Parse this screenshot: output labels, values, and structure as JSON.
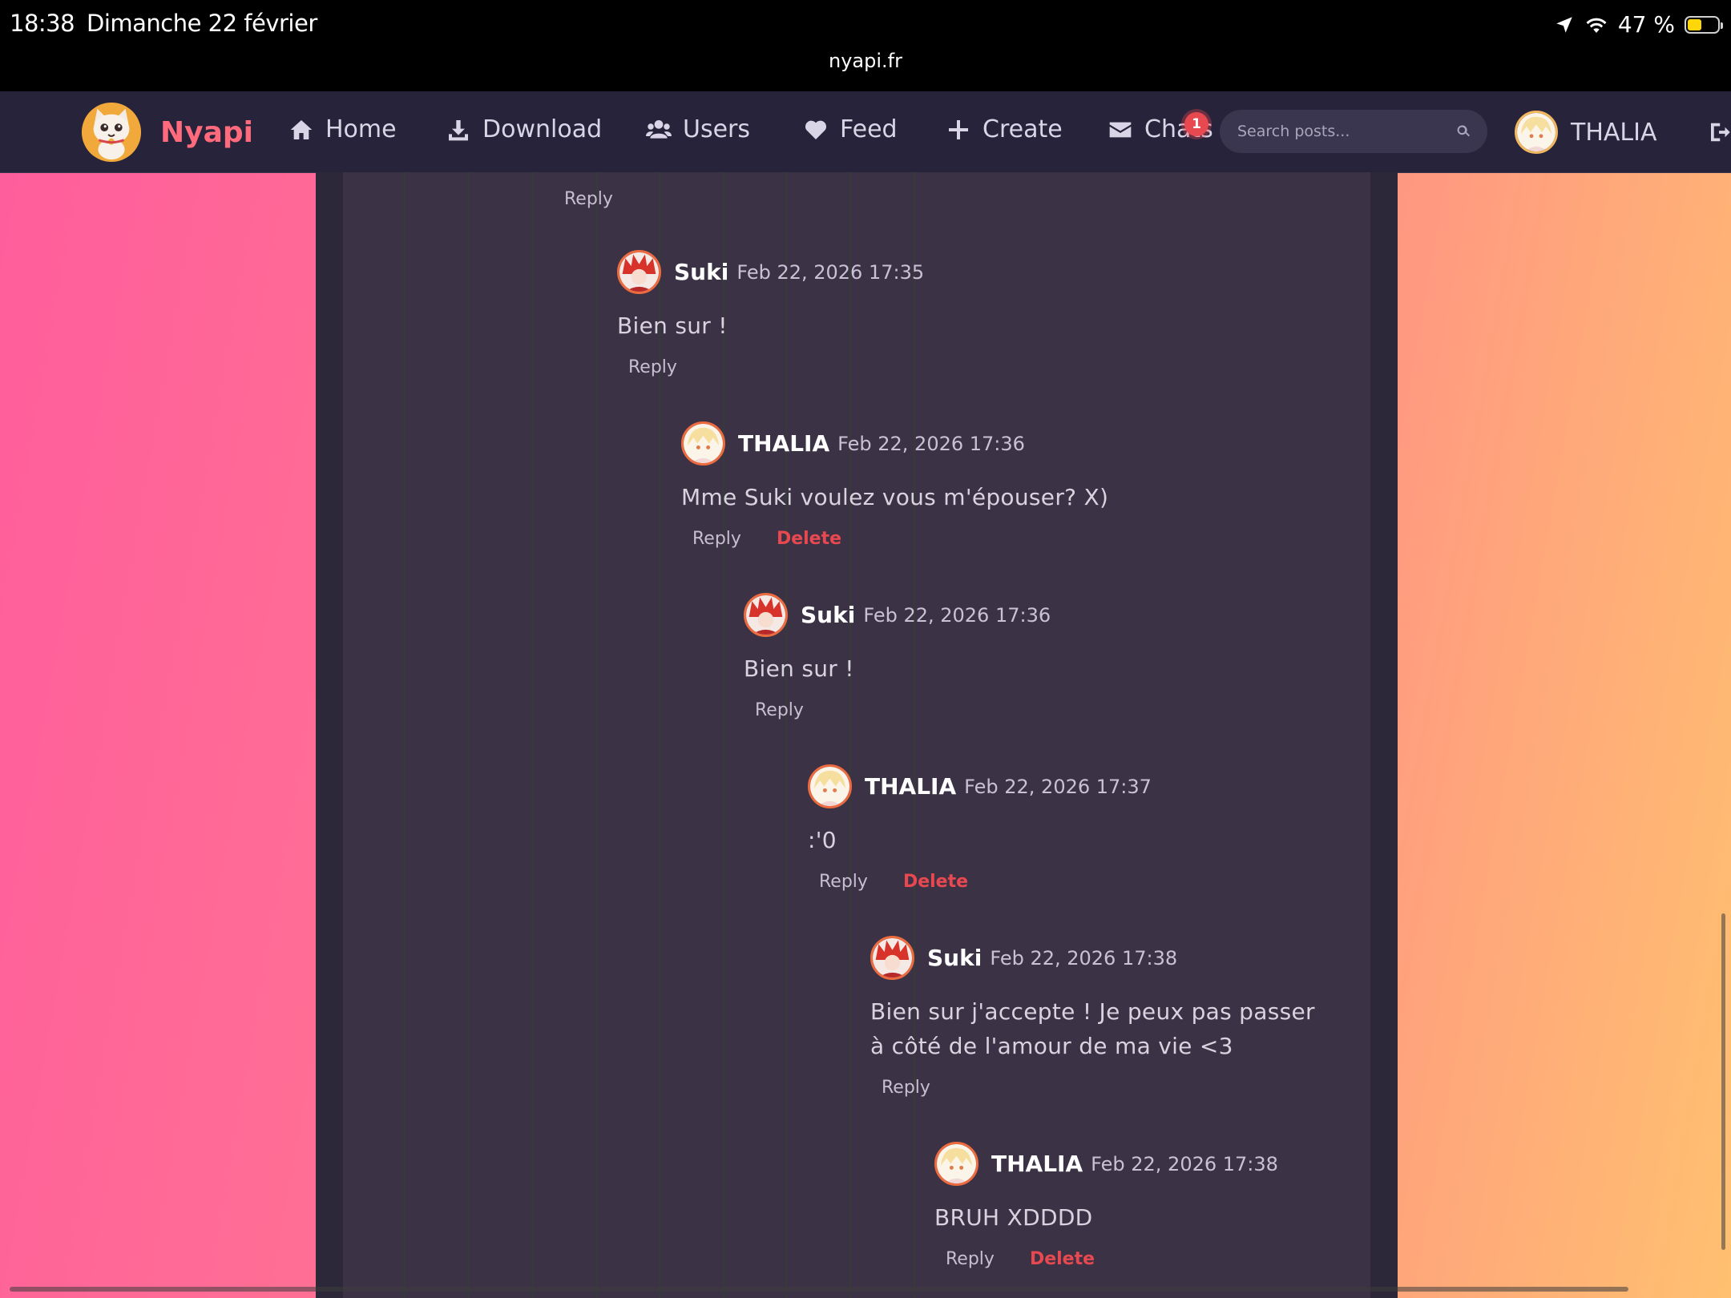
{
  "status_bar": {
    "time": "18:38",
    "date": "Dimanche 22 février",
    "url": "nyapi.fr",
    "battery": "47 %",
    "battery_level_percent": 47
  },
  "nav": {
    "brand": "Nyapi",
    "items": [
      "Home",
      "Download",
      "Users",
      "Feed",
      "Create",
      "Chats"
    ],
    "chat_badge": "1",
    "search_placeholder": "Search posts...",
    "user": "THALIA"
  },
  "thread": {
    "top_reply": "Reply",
    "comments": [
      {
        "author": "Suki",
        "time": "Feb 22, 2026 17:35",
        "body": "Bien sur !",
        "reply": "Reply",
        "delete": ""
      },
      {
        "author": "THALIA",
        "time": "Feb 22, 2026 17:36",
        "body": "Mme Suki voulez vous m'épouser? X)",
        "reply": "Reply",
        "delete": "Delete"
      },
      {
        "author": "Suki",
        "time": "Feb 22, 2026 17:36",
        "body": "Bien sur !",
        "reply": "Reply",
        "delete": ""
      },
      {
        "author": "THALIA",
        "time": "Feb 22, 2026 17:37",
        "body": ":'0",
        "reply": "Reply",
        "delete": "Delete"
      },
      {
        "author": "Suki",
        "time": "Feb 22, 2026 17:38",
        "body": "Bien sur j'accepte ! Je peux pas passer à côté de l'amour de ma vie <3",
        "reply": "Reply",
        "delete": ""
      },
      {
        "author": "THALIA",
        "time": "Feb 22, 2026 17:38",
        "body": "BRUH XDDDD",
        "reply": "Reply",
        "delete": "Delete"
      }
    ]
  },
  "colors": {
    "brand": "#ff6b7d",
    "delete": "#e8484f",
    "navbar": "#27233a",
    "comment_panel": "#3c3245"
  },
  "icons": [
    "home-icon",
    "download-icon",
    "users-icon",
    "heart-icon",
    "plus-icon",
    "envelope-icon",
    "search-icon",
    "logout-icon",
    "location-icon",
    "wifi-icon",
    "battery-icon"
  ]
}
